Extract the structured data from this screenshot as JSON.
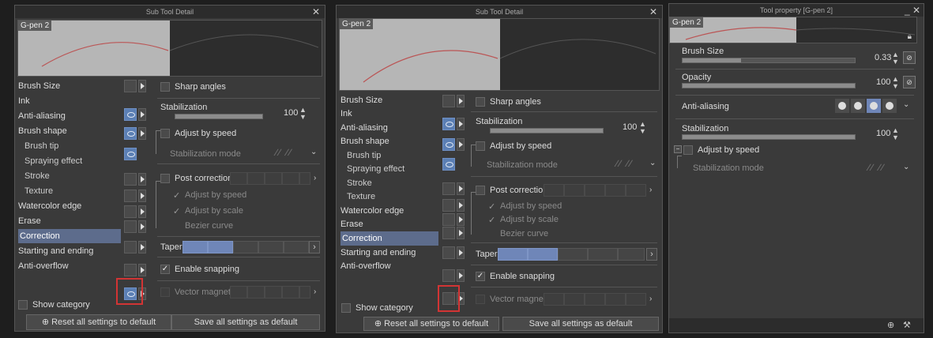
{
  "left": {
    "title": "Sub Tool Detail",
    "preview_tag": "G-pen 2",
    "categories": [
      "Brush Size",
      "Ink",
      "Anti-aliasing",
      "Brush shape",
      "Brush tip",
      "Spraying effect",
      "Stroke",
      "Texture",
      "Watercolor edge",
      "Erase",
      "Correction",
      "Starting and ending",
      "Anti-overflow"
    ],
    "selected": "Correction",
    "settings": {
      "sharp_angles": "Sharp angles",
      "stabilization": "Stabilization",
      "stabilization_value": "100",
      "adjust_by_speed": "Adjust by speed",
      "stabilization_mode": "Stabilization mode",
      "post_correction": "Post correction",
      "pc_adjust_speed": "Adjust by speed",
      "pc_adjust_scale": "Adjust by scale",
      "bezier_curve": "Bezier curve",
      "taper": "Taper",
      "enable_snapping": "Enable snapping",
      "vector_magnet": "Vector magnet"
    },
    "show_category": "Show category",
    "reset_button": "Reset all settings to default",
    "save_button": "Save all settings as default"
  },
  "middle": {
    "title": "Sub Tool Detail",
    "preview_tag": "G-pen 2",
    "categories": [
      "Brush Size",
      "Ink",
      "Anti-aliasing",
      "Brush shape",
      "Brush tip",
      "Spraying effect",
      "Stroke",
      "Texture",
      "Watercolor edge",
      "Erase",
      "Correction",
      "Starting and ending",
      "Anti-overflow"
    ],
    "selected": "Correction",
    "settings": {
      "sharp_angles": "Sharp angles",
      "stabilization": "Stabilization",
      "stabilization_value": "100",
      "adjust_by_speed": "Adjust by speed",
      "stabilization_mode": "Stabilization mode",
      "post_correction": "Post correction",
      "pc_adjust_speed": "Adjust by speed",
      "pc_adjust_scale": "Adjust by scale",
      "bezier_curve": "Bezier curve",
      "taper": "Taper",
      "enable_snapping": "Enable snapping",
      "vector_magnet": "Vector magnet"
    },
    "show_category": "Show category",
    "reset_button": "Reset all settings to default",
    "save_button": "Save all settings as default"
  },
  "right": {
    "title": "Tool property [G-pen 2]",
    "preview_tag": "G-pen 2",
    "brush_size_label": "Brush Size",
    "brush_size_value": "0.33",
    "opacity_label": "Opacity",
    "opacity_value": "100",
    "anti_aliasing_label": "Anti-aliasing",
    "stabilization_label": "Stabilization",
    "stabilization_value": "100",
    "adjust_by_speed": "Adjust by speed",
    "stabilization_mode": "Stabilization mode"
  },
  "colors": {
    "panel_bg": "#3a3a3a",
    "selection": "#5d6c8c",
    "accent_blue": "#6f86b8",
    "highlight_red": "#d23434"
  }
}
